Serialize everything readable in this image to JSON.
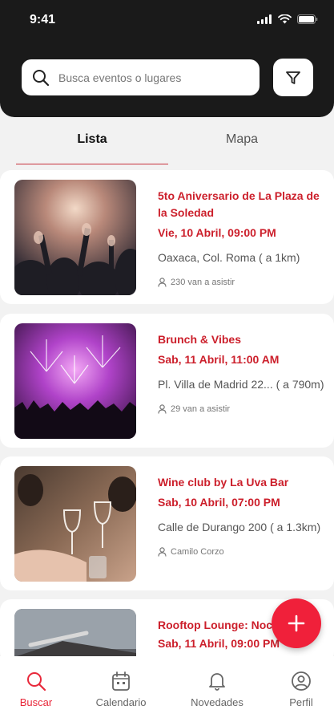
{
  "status_bar": {
    "time": "9:41"
  },
  "search": {
    "placeholder": "Busca eventos o lugares"
  },
  "tabs": [
    {
      "label": "Lista"
    },
    {
      "label": "Mapa"
    }
  ],
  "events": [
    {
      "title": "5to Aniversario de La Plaza de la Soledad",
      "date": "Vie, 10 Abril, 09:00 PM",
      "location": "Oaxaca, Col. Roma ( a 1km)",
      "attendance": "230 van a asistir"
    },
    {
      "title": "Brunch & Vibes",
      "date": "Sab, 11 Abril, 11:00 AM",
      "location": "Pl. Villa de Madrid 22... ( a 790m)",
      "attendance": "29 van a asistir"
    },
    {
      "title": "Wine club by La Uva Bar",
      "date": "Sab, 10 Abril, 07:00 PM",
      "location": "Calle de Durango 200 ( a 1.3km)",
      "attendance": "Camilo Corzo"
    },
    {
      "title": "Rooftop Lounge: Noc",
      "date": "Sab, 11 Abril, 09:00 PM"
    }
  ],
  "nav": [
    {
      "label": "Buscar",
      "icon": "search-icon"
    },
    {
      "label": "Calendario",
      "icon": "calendar-icon"
    },
    {
      "label": "Novedades",
      "icon": "bell-icon"
    },
    {
      "label": "Perfil",
      "icon": "user-icon"
    }
  ],
  "colors": {
    "accent": "#cc1f2b",
    "fab": "#f0203a",
    "header": "#1a1a1a"
  }
}
